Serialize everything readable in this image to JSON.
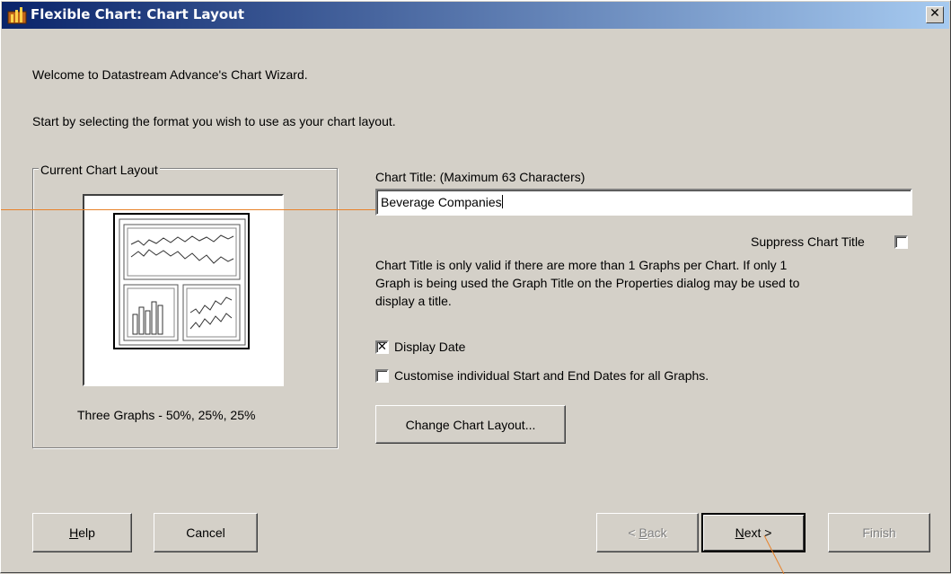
{
  "window": {
    "title": "Flexible Chart: Chart Layout",
    "close_label": "✕"
  },
  "intro": {
    "welcome": "Welcome to Datastream Advance's Chart Wizard.",
    "instruction": "Start by selecting the format you wish to use as your chart layout."
  },
  "layout_group": {
    "legend": "Current Chart Layout",
    "caption": "Three Graphs - 50%, 25%, 25%"
  },
  "chart_title": {
    "label": "Chart Title: (Maximum 63 Characters)",
    "value": "Beverage Companies"
  },
  "suppress": {
    "label": "Suppress Chart Title",
    "checked": false
  },
  "note": {
    "line1": "Chart Title is only valid if there are more than 1 Graphs per Chart. If only 1",
    "line2": "Graph is being used the Graph Title on the Properties dialog may be used to",
    "line3": "display a title."
  },
  "display_date": {
    "label": "Display Date",
    "checked": true,
    "mark": "✕"
  },
  "customise_dates": {
    "label": "Customise individual Start and End Dates for all Graphs.",
    "checked": false
  },
  "buttons": {
    "change_layout": "Change Chart Layout...",
    "help_first": "H",
    "help_rest": "elp",
    "cancel": "Cancel",
    "back_pre": "< ",
    "back_ul": "B",
    "back_rest": "ack",
    "next_ul": "N",
    "next_rest": "ext >",
    "finish": "Finish"
  },
  "colors": {
    "titlebar_start": "#0a246a",
    "titlebar_end": "#a6caf0",
    "annotation": "#e8822a"
  }
}
